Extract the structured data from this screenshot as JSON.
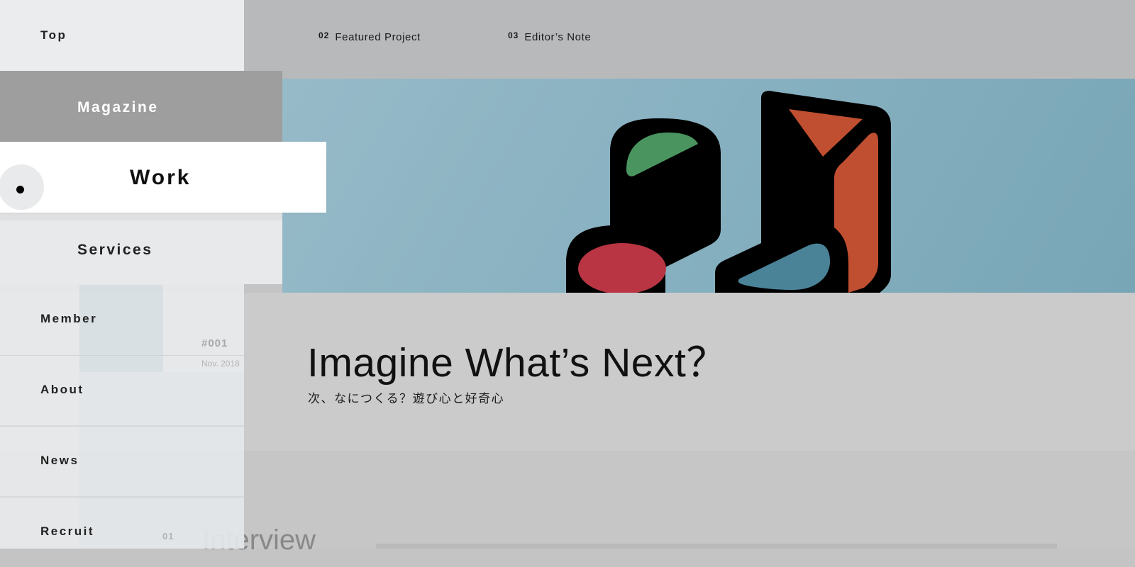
{
  "header": {
    "tabs": [
      {
        "num": "02",
        "label": "Featured Project"
      },
      {
        "num": "03",
        "label": "Editor’s Note"
      }
    ]
  },
  "nav": {
    "items": [
      {
        "label": "Top"
      },
      {
        "label": "Magazine"
      },
      {
        "label": "Work",
        "active": true
      },
      {
        "label": "Services"
      },
      {
        "label": "Member"
      },
      {
        "label": "About"
      },
      {
        "label": "News"
      },
      {
        "label": "Recruit"
      }
    ]
  },
  "article": {
    "issue": "#001",
    "date": "Nov. 2018",
    "title": "Imagine What’s Next？",
    "subtitle": "次、なにつくる？遊び心と好奇心",
    "section_heading": "Interview",
    "section_num": "01"
  },
  "colors": {
    "hero_bg": "#8cb3c3",
    "accent_red": "#b93543",
    "accent_green": "#4a9460",
    "accent_orange": "#bf4f30",
    "accent_blue": "#4a8398"
  },
  "icons": {
    "hero_art": "abstract-toy-shapes-illustration"
  }
}
